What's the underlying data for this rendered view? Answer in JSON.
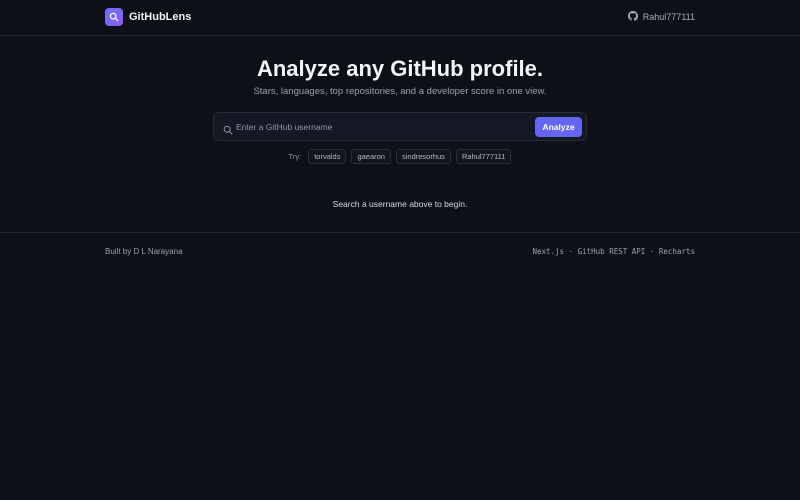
{
  "header": {
    "brand": "GitHubLens",
    "user": "Rahul777111",
    "logo_icon": "search-icon",
    "user_icon": "github-icon",
    "accent_color": "#6366f1"
  },
  "hero": {
    "title": "Analyze any GitHub profile.",
    "subtitle": "Stars, languages, top repositories, and a developer score in one view."
  },
  "search": {
    "placeholder": "Enter a GitHub username",
    "value": "",
    "button_label": "Analyze"
  },
  "suggestions": {
    "label": "Try:",
    "items": [
      "torvalds",
      "gaearon",
      "sindresorhus",
      "Rahul777111"
    ]
  },
  "empty_state": {
    "message": "Search a username above to begin."
  },
  "footer": {
    "credit": "Built by D L Narayana",
    "tech": "Next.js · GitHub REST API · Recharts"
  }
}
